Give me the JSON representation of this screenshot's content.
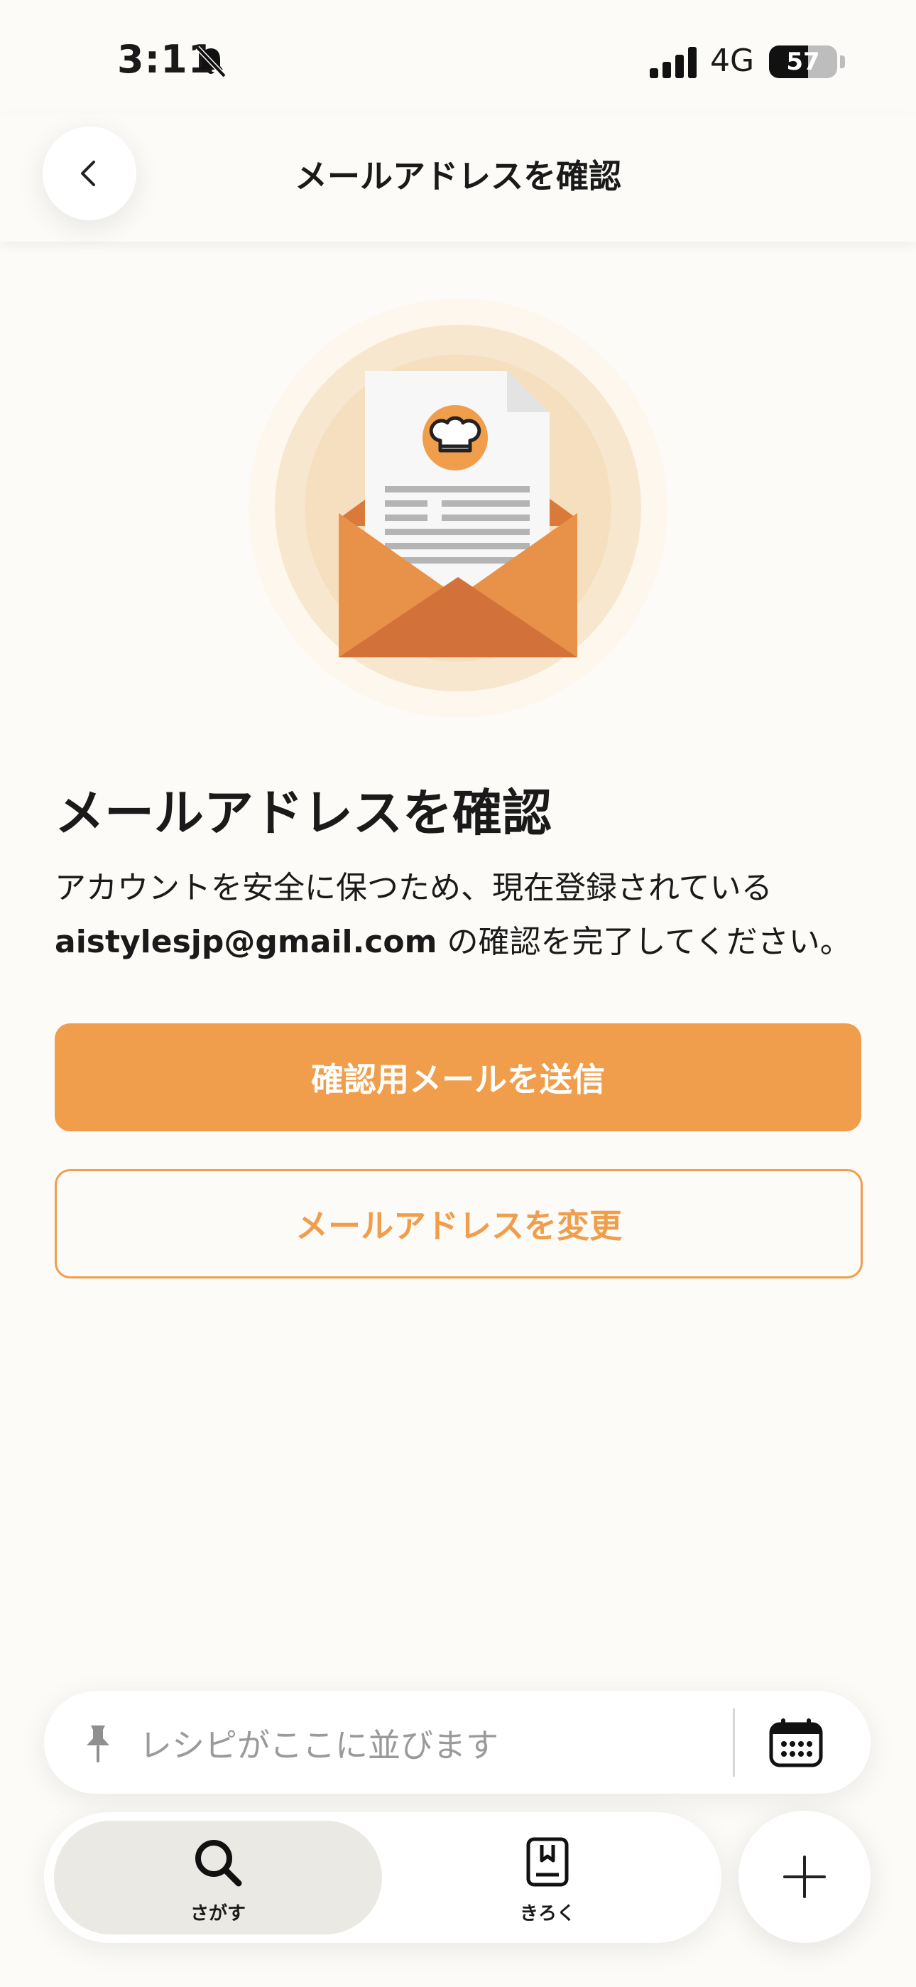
{
  "status_bar": {
    "time": "3:11",
    "network": "4G",
    "battery_level": 57,
    "battery_label": "57",
    "icons": [
      "bell-slash-icon",
      "cellular-signal-icon",
      "battery-icon"
    ]
  },
  "header": {
    "title": "メールアドレスを確認",
    "back_icon": "chevron-left-icon"
  },
  "illustration": {
    "icon": "envelope-letter-chef-hat-icon"
  },
  "content": {
    "heading": "メールアドレスを確認",
    "description_line1": "アカウントを安全に保つため、現在登録されている",
    "email": "aistylesjp@gmail.com",
    "description_line2_suffix": " の確認を完了してください。"
  },
  "buttons": {
    "send_verification": "確認用メールを送信",
    "change_email": "メールアドレスを変更"
  },
  "recipe_bar": {
    "placeholder": "レシピがここに並びます",
    "pin_icon": "pin-icon",
    "calendar_icon": "calendar-icon"
  },
  "tab_bar": {
    "tabs": [
      {
        "label": "さがす",
        "icon": "search-icon",
        "selected": true
      },
      {
        "label": "きろく",
        "icon": "notebook-icon",
        "selected": false
      }
    ],
    "add_icon": "plus-icon"
  },
  "colors": {
    "accent": "#f09e4b",
    "background": "#fcfbf8",
    "envelope": "#e0864a"
  }
}
